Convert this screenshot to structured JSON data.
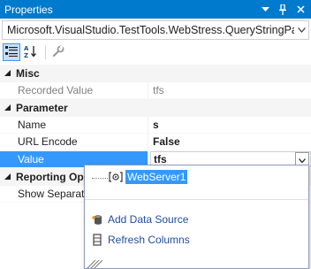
{
  "window": {
    "title": "Properties"
  },
  "object_selector": {
    "value": "Microsoft.VisualStudio.TestTools.WebStress.QueryStringPara"
  },
  "grid": {
    "categories": [
      {
        "label": "Misc"
      },
      {
        "label": "Parameter"
      },
      {
        "label": "Reporting Op"
      }
    ],
    "misc": {
      "recorded_value": {
        "name": "Recorded Value",
        "value": "tfs"
      }
    },
    "parameter": {
      "name": {
        "name": "Name",
        "value": "s"
      },
      "url_encode": {
        "name": "URL Encode",
        "value": "False"
      },
      "value": {
        "name": "Value",
        "value": "tfs"
      }
    },
    "reporting": {
      "show_separate": {
        "name": "Show Separate"
      }
    }
  },
  "popup": {
    "tree_item": "WebServer1",
    "add_data_source": "Add Data Source",
    "refresh_columns": "Refresh Columns"
  },
  "colors": {
    "accent": "#007acc",
    "selection": "#3399ff",
    "link": "#1e4e9e",
    "category_bg": "#f5f5f5"
  }
}
